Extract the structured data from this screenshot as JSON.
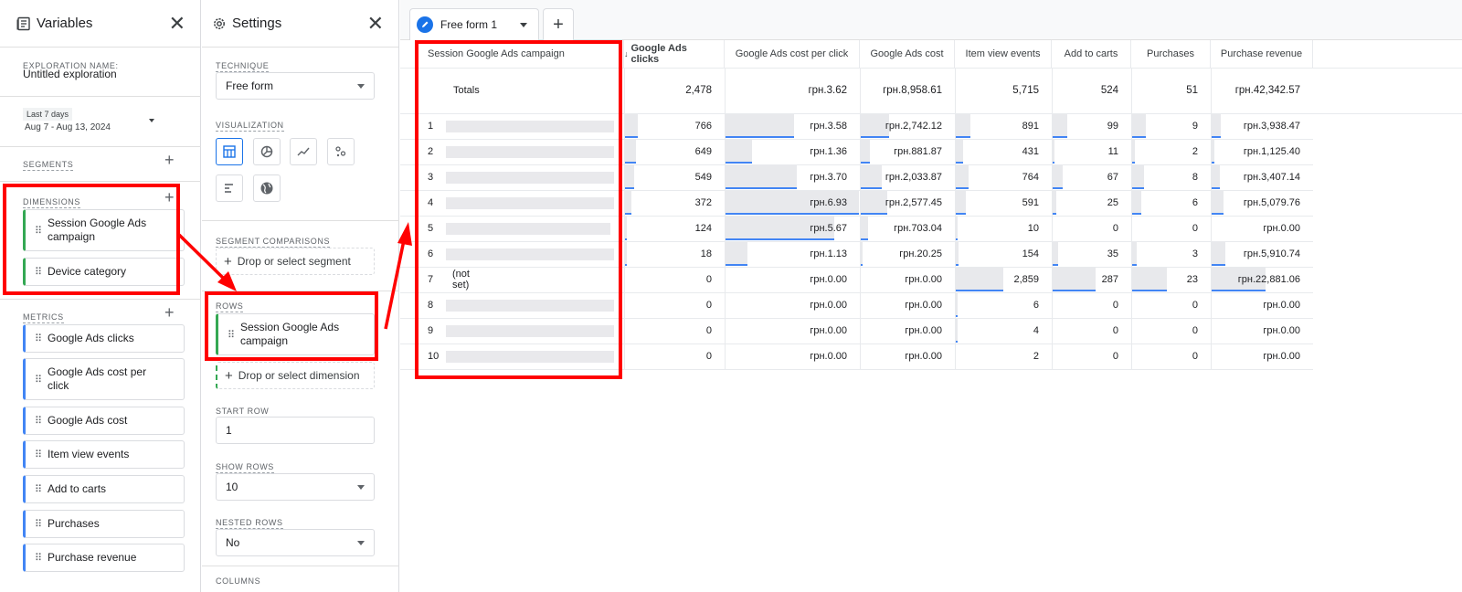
{
  "variables_panel": {
    "title": "Variables",
    "exploration_name_label": "EXPLORATION NAME:",
    "exploration_name": "Untitled exploration",
    "date_preset": "Last 7 days",
    "date_range": "Aug 7 - Aug 13, 2024",
    "segments_label": "SEGMENTS",
    "dimensions_label": "DIMENSIONS",
    "dimensions": [
      "Session Google Ads campaign",
      "Device category"
    ],
    "metrics_label": "METRICS",
    "metrics": [
      "Google Ads clicks",
      "Google Ads cost per click",
      "Google Ads cost",
      "Item view events",
      "Add to carts",
      "Purchases",
      "Purchase revenue"
    ]
  },
  "settings_panel": {
    "title": "Settings",
    "technique_label": "TECHNIQUE",
    "technique_value": "Free form",
    "visualization_label": "VISUALIZATION",
    "visualization_icons": [
      "table-icon",
      "donut-chart-icon",
      "line-chart-icon",
      "scatter-plot-icon",
      "bar-chart-icon",
      "globe-icon"
    ],
    "segment_comparisons_label": "SEGMENT COMPARISONS",
    "segment_drop": "Drop or select segment",
    "rows_label": "ROWS",
    "row_dimension": "Session Google Ads campaign",
    "dimension_drop": "Drop or select dimension",
    "start_row_label": "START ROW",
    "start_row_value": "1",
    "show_rows_label": "SHOW ROWS",
    "show_rows_value": "10",
    "nested_rows_label": "NESTED ROWS",
    "nested_rows_value": "No",
    "columns_label": "COLUMNS"
  },
  "tab": {
    "name": "Free form 1"
  },
  "table": {
    "dimension_header": "Session Google Ads campaign",
    "headers": [
      "Google Ads clicks",
      "Google Ads cost per click",
      "Google Ads cost",
      "Item view events",
      "Add to carts",
      "Purchases",
      "Purchase revenue"
    ],
    "totals_label": "Totals",
    "totals": [
      "2,478",
      "грн.3.62",
      "грн.8,958.61",
      "5,715",
      "524",
      "51",
      "грн.42,342.57"
    ],
    "rows": [
      {
        "n": "1",
        "label": "",
        "values": [
          "766",
          "грн.3.58",
          "грн.2,742.12",
          "891",
          "99",
          "9",
          "грн.3,938.47"
        ],
        "fractions": [
          0.134,
          0.517,
          0.306,
          0.156,
          0.189,
          0.176,
          0.093
        ]
      },
      {
        "n": "2",
        "label": "",
        "values": [
          "649",
          "грн.1.36",
          "грн.881.87",
          "431",
          "11",
          "2",
          "грн.1,125.40"
        ],
        "fractions": [
          0.114,
          0.196,
          0.098,
          0.075,
          0.021,
          0.039,
          0.027
        ]
      },
      {
        "n": "3",
        "label": "",
        "values": [
          "549",
          "грн.3.70",
          "грн.2,033.87",
          "764",
          "67",
          "8",
          "грн.3,407.14"
        ],
        "fractions": [
          0.096,
          0.534,
          0.227,
          0.134,
          0.128,
          0.157,
          0.08
        ]
      },
      {
        "n": "4",
        "label": "",
        "values": [
          "372",
          "грн.6.93",
          "грн.2,577.45",
          "591",
          "25",
          "6",
          "грн.5,079.76"
        ],
        "fractions": [
          0.065,
          1.0,
          0.288,
          0.103,
          0.048,
          0.118,
          0.12
        ]
      },
      {
        "n": "5",
        "label": "",
        "values": [
          "124",
          "грн.5.67",
          "грн.703.04",
          "10",
          "0",
          "0",
          "грн.0.00"
        ],
        "fractions": [
          0.022,
          0.818,
          0.078,
          0.002,
          0,
          0,
          0
        ]
      },
      {
        "n": "6",
        "label": "",
        "values": [
          "18",
          "грн.1.13",
          "грн.20.25",
          "154",
          "35",
          "3",
          "грн.5,910.74"
        ],
        "fractions": [
          0.003,
          0.163,
          0.002,
          0.027,
          0.067,
          0.059,
          0.14
        ]
      },
      {
        "n": "7",
        "label": "(not set)",
        "values": [
          "0",
          "грн.0.00",
          "грн.0.00",
          "2,859",
          "287",
          "23",
          "грн.22,881.06"
        ],
        "fractions": [
          0,
          0,
          0,
          0.5,
          0.548,
          0.451,
          0.54
        ]
      },
      {
        "n": "8",
        "label": "",
        "values": [
          "0",
          "грн.0.00",
          "грн.0.00",
          "6",
          "0",
          "0",
          "грн.0.00"
        ],
        "fractions": [
          0,
          0,
          0,
          0.001,
          0,
          0,
          0
        ]
      },
      {
        "n": "9",
        "label": "",
        "values": [
          "0",
          "грн.0.00",
          "грн.0.00",
          "4",
          "0",
          "0",
          "грн.0.00"
        ],
        "fractions": [
          0,
          0,
          0,
          0.001,
          0,
          0,
          0
        ]
      },
      {
        "n": "10",
        "label": "",
        "values": [
          "0",
          "грн.0.00",
          "грн.0.00",
          "2",
          "0",
          "0",
          "грн.0.00"
        ],
        "fractions": [
          0,
          0,
          0,
          0,
          0,
          0,
          0
        ]
      }
    ]
  },
  "colors": {
    "accent": "#1a73e8",
    "dimension": "#34a853",
    "metric": "#4285f4",
    "annotation": "#ff0000",
    "bar": "#e8e9ec"
  }
}
